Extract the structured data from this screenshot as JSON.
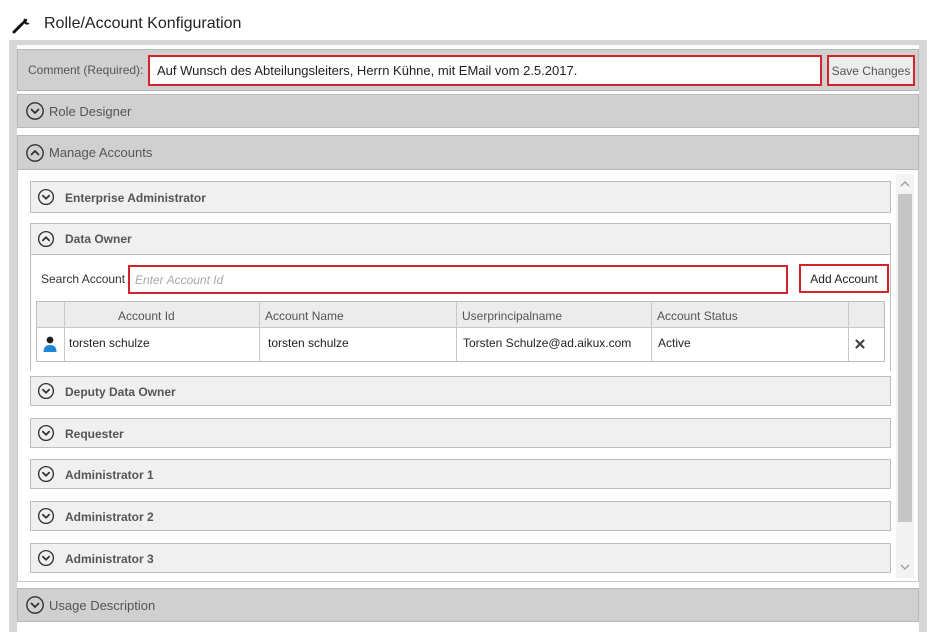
{
  "window": {
    "title": "Rolle/Account Konfiguration",
    "icon": "wrench-icon"
  },
  "comment": {
    "label": "Comment (Required):",
    "value": "Auf Wunsch des Abteilungsleiters, Herrn Kühne, mit EMail vom 2.5.2017.",
    "save_label": "Save Changes"
  },
  "sections": {
    "role_designer": {
      "label": "Role Designer",
      "state": "collapsed"
    },
    "manage_accounts": {
      "label": "Manage Accounts",
      "state": "expanded"
    },
    "usage_description": {
      "label": "Usage Description",
      "state": "collapsed"
    }
  },
  "roles": {
    "enterprise_admin": {
      "label": "Enterprise Administrator",
      "state": "collapsed"
    },
    "data_owner": {
      "label": "Data Owner",
      "state": "expanded"
    },
    "deputy_data_owner": {
      "label": "Deputy Data Owner",
      "state": "collapsed"
    },
    "requester": {
      "label": "Requester",
      "state": "collapsed"
    },
    "administrator_1": {
      "label": "Administrator 1",
      "state": "collapsed"
    },
    "administrator_2": {
      "label": "Administrator 2",
      "state": "collapsed"
    },
    "administrator_3": {
      "label": "Administrator 3",
      "state": "collapsed"
    }
  },
  "data_owner": {
    "search_label": "Search Account",
    "search_placeholder": "Enter Account Id",
    "add_label": "Add Account",
    "columns": [
      "Account Id",
      "Account Name",
      "Userprincipalname",
      "Account Status"
    ],
    "rows": [
      {
        "account_id": "torsten schulze",
        "account_name": "torsten schulze",
        "upn": "Torsten Schulze@ad.aikux.com",
        "status": "Active"
      }
    ]
  },
  "colors": {
    "highlight_border": "#d3232b",
    "section_bar": "#d0d0d0",
    "user_icon": "#1f87d8"
  }
}
